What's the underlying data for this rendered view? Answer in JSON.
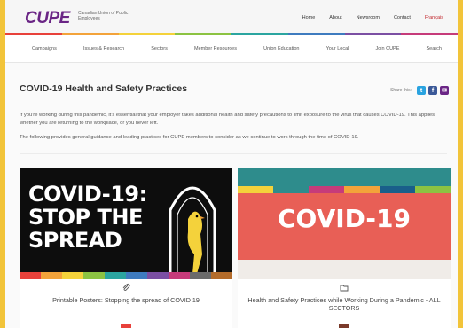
{
  "header": {
    "logo": "CUPE",
    "logo_sub": "Canadian Union of Public Employees",
    "links": [
      "Home",
      "About",
      "Newsroom",
      "Contact"
    ],
    "lang_link": "Français"
  },
  "nav": {
    "items": [
      "Campaigns",
      "Issues & Research",
      "Sectors",
      "Member Resources",
      "Union Education",
      "Your Local",
      "Join CUPE",
      "Search"
    ]
  },
  "page": {
    "title": "COVID-19 Health and Safety Practices",
    "share_label": "Share this:",
    "intro_1": "If you're working during this pandemic, it's essential that your employer takes additional health and safety precautions to limit exposure to the virus that causes COVID-19. This applies whether you are returning to the workplace, or you never left.",
    "intro_2": "The following provides general guidance and leading practices for CUPE members to consider as we continue to work through the time of COVID-19."
  },
  "cards": [
    {
      "image_text": "COVID-19: STOP THE SPREAD",
      "icon": "paperclip-icon",
      "title": "Printable Posters: Stopping the spread of COVID 19"
    },
    {
      "image_text": "COVID-19",
      "icon": "folder-icon",
      "title": "Health and Safety Practices while Working During a Pandemic - ALL SECTORS"
    }
  ],
  "colors": {
    "brand_purple": "#6a2585",
    "accent_red": "#c1272d",
    "frame_yellow": "#f2c43a",
    "stripe": [
      "#e8413b",
      "#f3a33a",
      "#f4d23b",
      "#8cc342",
      "#2ba5a0",
      "#3e7bbf",
      "#7b4fa3",
      "#c63b7a"
    ]
  }
}
